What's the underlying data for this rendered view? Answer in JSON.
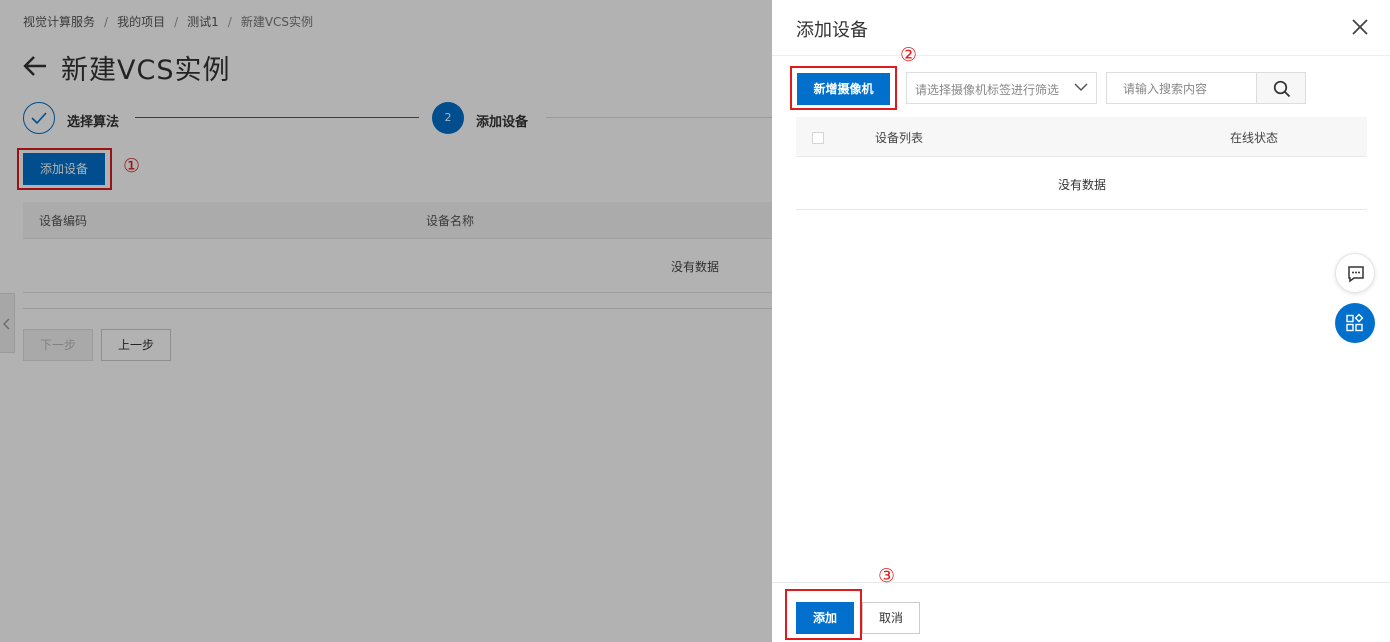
{
  "breadcrumb": {
    "items": [
      "视觉计算服务",
      "我的项目",
      "测试1"
    ],
    "current": "新建VCS实例",
    "separator": "/"
  },
  "page": {
    "title": "新建VCS实例",
    "back_icon": "arrow-left-icon"
  },
  "steps": [
    {
      "label": "选择算法",
      "status": "done",
      "icon": "check-icon"
    },
    {
      "label": "添加设备",
      "status": "current",
      "number": "2"
    }
  ],
  "bg_actions": {
    "add_device_label": "添加设备"
  },
  "bg_table": {
    "columns": [
      "设备编码",
      "设备名称"
    ],
    "empty_text": "没有数据"
  },
  "bg_nav": {
    "next_label": "下一步",
    "prev_label": "上一步"
  },
  "annotations": [
    "①",
    "②",
    "③"
  ],
  "drawer": {
    "title": "添加设备",
    "close_icon": "close-icon",
    "new_camera_label": "新增摄像机",
    "tag_filter_placeholder": "请选择摄像机标签进行筛选",
    "search_placeholder": "请输入搜索内容",
    "search_icon": "search-icon",
    "table": {
      "columns": [
        "设备列表",
        "在线状态"
      ],
      "empty_text": "没有数据"
    },
    "footer": {
      "add_label": "添加",
      "cancel_label": "取消"
    }
  },
  "floating": {
    "chat_icon": "chat-icon",
    "apps_icon": "apps-icon"
  },
  "colors": {
    "primary": "#0070cc",
    "annotation_red": "#e01b1b",
    "mask": "rgba(0,0,0,0.30)"
  }
}
